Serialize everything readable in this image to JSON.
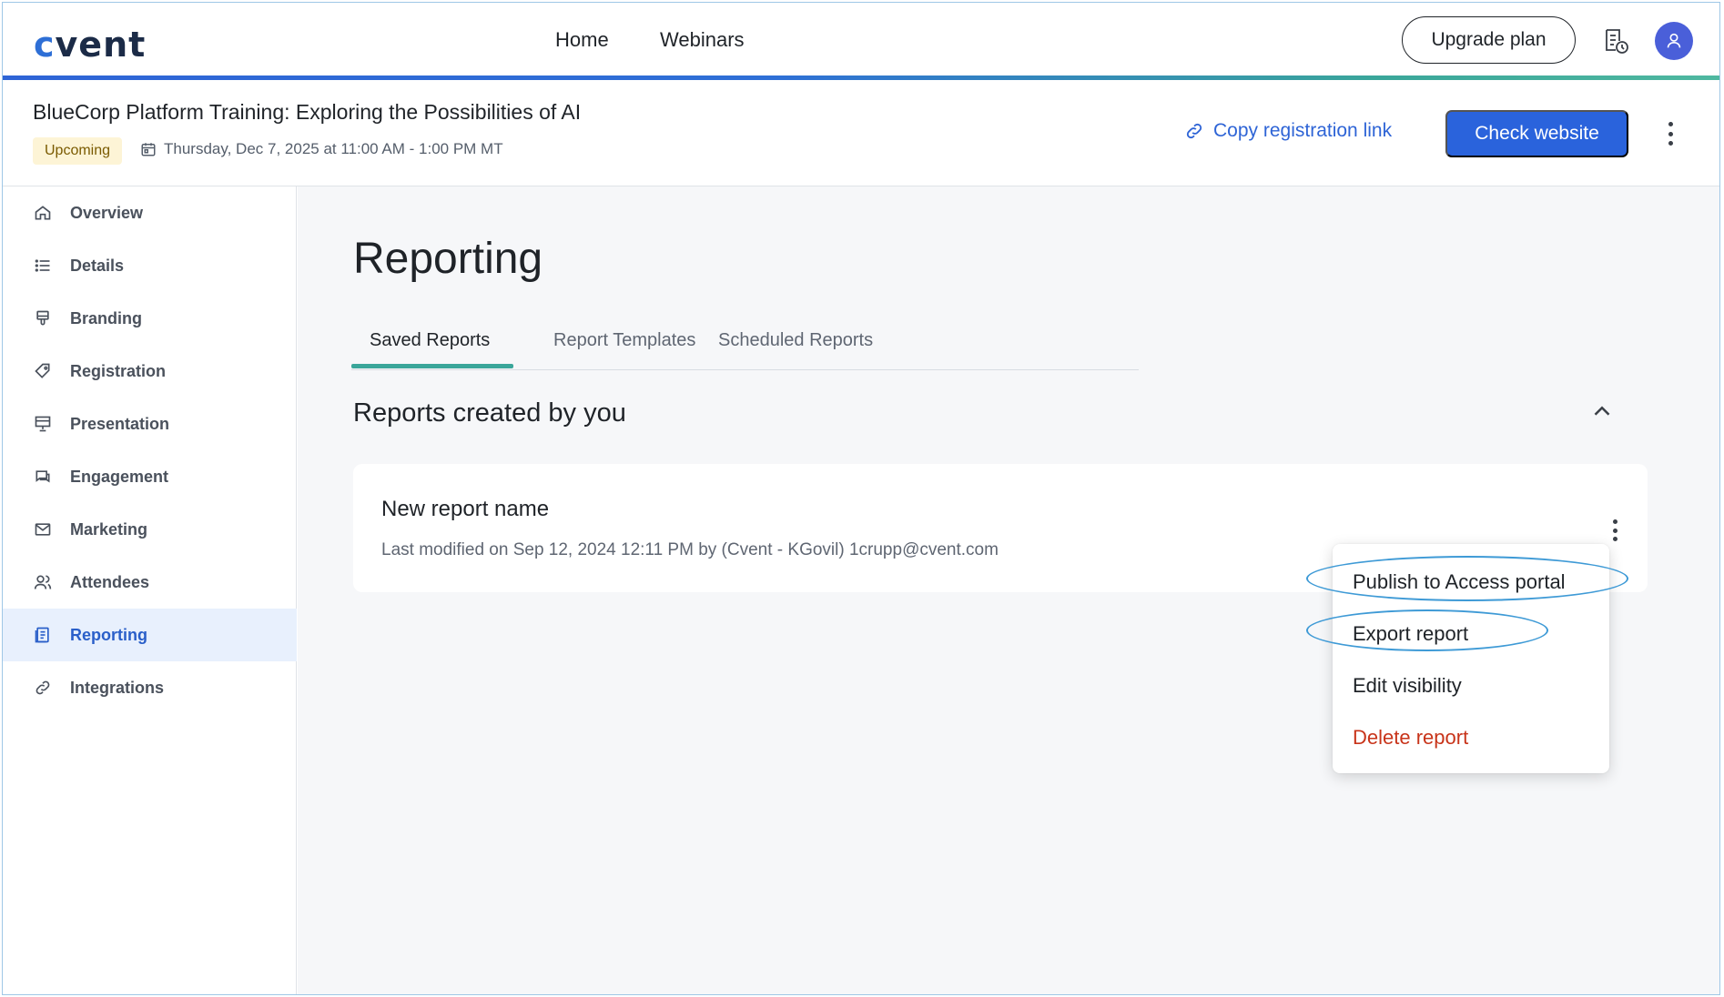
{
  "topnav": {
    "logo": "cvent",
    "links": [
      "Home",
      "Webinars"
    ],
    "upgrade_label": "Upgrade plan",
    "icons": [
      "report-clock-icon",
      "user-avatar-icon"
    ]
  },
  "event": {
    "title": "BlueCorp Platform Training: Exploring the Possibilities of AI",
    "status": "Upcoming",
    "date": "Thursday, Dec 7, 2025 at 11:00 AM - 1:00 PM MT",
    "copy_link_label": "Copy registration link",
    "check_website_label": "Check website"
  },
  "sidebar": {
    "items": [
      {
        "label": "Overview",
        "icon": "home-icon",
        "active": false
      },
      {
        "label": "Details",
        "icon": "list-icon",
        "active": false
      },
      {
        "label": "Branding",
        "icon": "brush-icon",
        "active": false
      },
      {
        "label": "Registration",
        "icon": "tag-icon",
        "active": false
      },
      {
        "label": "Presentation",
        "icon": "presentation-icon",
        "active": false
      },
      {
        "label": "Engagement",
        "icon": "chat-icon",
        "active": false
      },
      {
        "label": "Marketing",
        "icon": "mail-icon",
        "active": false
      },
      {
        "label": "Attendees",
        "icon": "people-icon",
        "active": false
      },
      {
        "label": "Reporting",
        "icon": "report-icon",
        "active": true
      },
      {
        "label": "Integrations",
        "icon": "link-icon",
        "active": false
      }
    ]
  },
  "main": {
    "title": "Reporting",
    "tabs": [
      {
        "label": "Saved Reports",
        "active": true
      },
      {
        "label": "Report Templates",
        "active": false
      },
      {
        "label": "Scheduled Reports",
        "active": false
      }
    ],
    "section_title": "Reports created by you",
    "report": {
      "name": "New report name",
      "meta": "Last modified on Sep 12, 2024 12:11 PM by (Cvent - KGovil) 1crupp@cvent.com"
    },
    "menu": {
      "items": [
        {
          "label": "Publish to Access portal",
          "danger": false
        },
        {
          "label": "Export report",
          "danger": false
        },
        {
          "label": "Edit visibility",
          "danger": false
        },
        {
          "label": "Delete report",
          "danger": true
        }
      ]
    }
  },
  "colors": {
    "primary": "#2a63dc",
    "accent_teal": "#3aa69a",
    "danger": "#c8341a",
    "badge_bg": "#fdf4d6",
    "highlight": "#3e9ad6"
  }
}
